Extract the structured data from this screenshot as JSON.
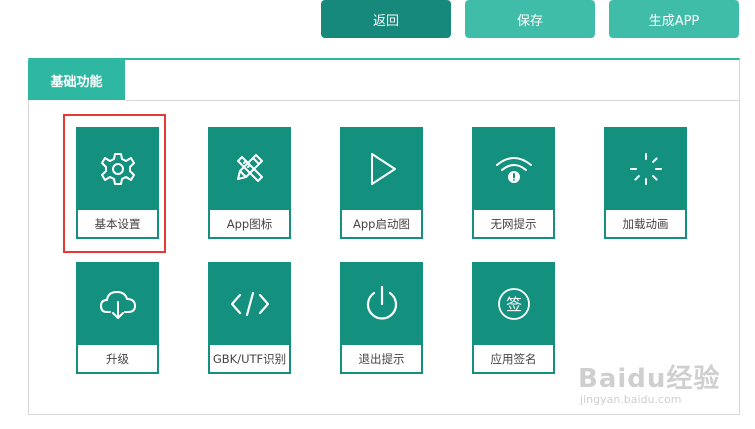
{
  "toolbar": {
    "back_label": "返回",
    "save_label": "保存",
    "generate_label": "生成APP"
  },
  "panel": {
    "tab_label": "基础功能"
  },
  "tiles": [
    {
      "label": "基本设置",
      "icon": "gear-icon"
    },
    {
      "label": "App图标",
      "icon": "pencil-ruler-icon"
    },
    {
      "label": "App启动图",
      "icon": "play-icon"
    },
    {
      "label": "无网提示",
      "icon": "wifi-alert-icon"
    },
    {
      "label": "加载动画",
      "icon": "loading-spinner-icon"
    },
    {
      "label": "升级",
      "icon": "cloud-download-icon"
    },
    {
      "label": "GBK/UTF识别",
      "icon": "code-icon"
    },
    {
      "label": "退出提示",
      "icon": "power-icon"
    },
    {
      "label": "应用签名",
      "icon": "sign-icon"
    }
  ],
  "watermark": {
    "logo": "Baidu经验",
    "url": "jingyan.baidu.com"
  },
  "colors": {
    "primary": "#14907f",
    "accent": "#2eb8a1",
    "button_dark": "#16897a",
    "highlight": "#e53935"
  }
}
